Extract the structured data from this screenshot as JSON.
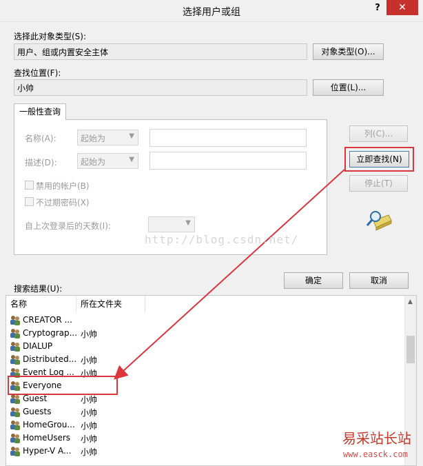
{
  "window": {
    "title": "选择用户或组",
    "help": "?",
    "close": "✕"
  },
  "object_type": {
    "label": "选择此对象类型(S):",
    "value": "用户、组或内置安全主体",
    "button": "对象类型(O)..."
  },
  "location": {
    "label": "查找位置(F):",
    "value": "小帅",
    "button": "位置(L)..."
  },
  "query": {
    "tab": "一般性查询",
    "name_label": "名称(A):",
    "name_mode": "起始为",
    "desc_label": "描述(D):",
    "desc_mode": "起始为",
    "disabled_accounts": "禁用的帐户(B)",
    "non_expiring": "不过期密码(X)",
    "days_label": "自上次登录后的天数(I):"
  },
  "actions": {
    "columns": "列(C)...",
    "find_now": "立即查找(N)",
    "stop": "停止(T)",
    "ok": "确定",
    "cancel": "取消"
  },
  "results": {
    "label": "搜索结果(U):",
    "headers": {
      "name": "名称",
      "folder": "所在文件夹"
    },
    "rows": [
      {
        "name": "CREATOR ...",
        "folder": ""
      },
      {
        "name": "Cryptograp...",
        "folder": "小帅"
      },
      {
        "name": "DIALUP",
        "folder": ""
      },
      {
        "name": "Distributed...",
        "folder": "小帅"
      },
      {
        "name": "Event Log ...",
        "folder": "小帅"
      },
      {
        "name": "Everyone",
        "folder": ""
      },
      {
        "name": "Guest",
        "folder": "小帅"
      },
      {
        "name": "Guests",
        "folder": "小帅"
      },
      {
        "name": "HomeGrou...",
        "folder": "小帅"
      },
      {
        "name": "HomeUsers",
        "folder": "小帅"
      },
      {
        "name": "Hyper-V A...",
        "folder": "小帅"
      }
    ]
  },
  "watermarks": {
    "blog": "http://blog.csdn.net/",
    "site_cn": "易采站长站",
    "site_url": "www.easck.com"
  },
  "colors": {
    "highlight": "#d9363e",
    "close_bg": "#c7312b"
  }
}
